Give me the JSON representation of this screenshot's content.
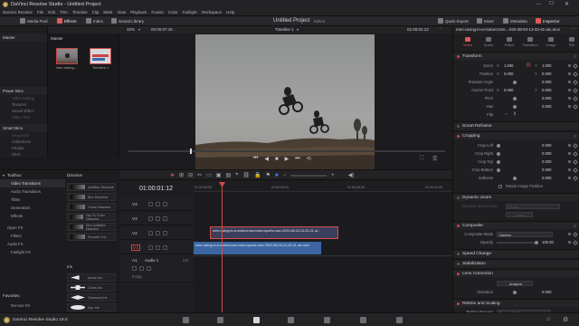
{
  "window": {
    "title": "DaVinci Resolve Studio - Untitled Project"
  },
  "menu": [
    "DaVinci Resolve",
    "File",
    "Edit",
    "Trim",
    "Timeline",
    "Clip",
    "Mark",
    "View",
    "Playback",
    "Fusion",
    "Color",
    "Fairlight",
    "Workspace",
    "Help"
  ],
  "project": {
    "name": "Untitled Project",
    "status": "Edited"
  },
  "toolbar": {
    "media_pool": "Media Pool",
    "effects": "Effects",
    "index": "Index",
    "sound_library": "Sound Library",
    "quick_export": "Quick Export",
    "mixer": "Mixer",
    "metadata": "Metadata",
    "inspector": "Inspector"
  },
  "left_panel": {
    "master": "Master",
    "power_bins": "Power Bins",
    "power_items": [
      "Video Editing",
      "Textures",
      "Sound Effect",
      "Video Tour"
    ],
    "smart_bins": "Smart Bins",
    "smart_items": [
      "Keywords",
      "Collections",
      "People",
      "Shot"
    ]
  },
  "media_pool": {
    "bin": "Master",
    "clips": [
      {
        "name": "men-racing-..."
      },
      {
        "name": "Timeline 1"
      }
    ]
  },
  "viewer": {
    "zoom": "32%",
    "source_timecode": "00:00:07:15",
    "timeline_name": "Timeline 1",
    "timecode": "01:00:01:12",
    "clip_file": "men-racing-in-a-motorcross-...022-08-04-13-23-41-utc.mov"
  },
  "effects_library": {
    "toolbox": "Toolbox",
    "items": [
      "Video Transitions",
      "Audio Transitions",
      "Titles",
      "Generators",
      "Effects",
      "Open FX",
      "Filters",
      "Audio FX",
      "Fairlight FX"
    ],
    "selected": "Video Transitions",
    "dissolve_header": "Dissolve",
    "dissolve_items": [
      "Additive Dissolve",
      "Blur Dissolve",
      "Cross Dissolve",
      "Dip To Color Dissolve",
      "Non-Additive Dissolve",
      "Smooth Cut"
    ],
    "iris_header": "Iris",
    "iris_items": [
      "Arrow Iris",
      "Cross Iris",
      "Diamond Iris",
      "Eye Iris"
    ],
    "favorites": "Favorites",
    "favorite_item": "Remote R3"
  },
  "timeline": {
    "timecode": "01:00:01:12",
    "ruler": [
      "01:00:00:00",
      "01:00:04:00",
      "01:00:08:00",
      "01:00:12:00"
    ],
    "tracks": [
      {
        "name": "V4",
        "type": "video"
      },
      {
        "name": "V3",
        "type": "video"
      },
      {
        "name": "V2",
        "type": "video"
      },
      {
        "name": "V1",
        "type": "video"
      },
      {
        "name": "A1",
        "type": "audio",
        "label": "Audio 1",
        "count": "2.0",
        "clips": "0 Clip"
      }
    ],
    "clips": [
      {
        "track": "V2",
        "name": "men-racing-in-a-motorcross-motor-sports-race-2022-08-04-13-23-41-ut..."
      },
      {
        "track": "V1",
        "name": "men-racing-in-a-motorcross-motor-sports-race-2022-08-04-13-23-41-utc.mov"
      }
    ]
  },
  "inspector": {
    "file": "men-racing-in-a-motorcross-...022-08-04-13-23-41-utc.mov",
    "tabs": [
      "Video",
      "Audio",
      "Effect",
      "Transition",
      "Image",
      "File"
    ],
    "active_tab": "Video",
    "transform": {
      "title": "Transform",
      "zoom_x": "1.000",
      "zoom_y": "1.000",
      "position_x": "0.000",
      "position_y": "0.000",
      "rotation": "0.000",
      "anchor_x": "0.000",
      "anchor_y": "0.000",
      "pitch": "0.000",
      "yaw": "0.000",
      "labels": [
        "Zoom",
        "Position",
        "Rotation Angle",
        "Anchor Point",
        "Pitch",
        "Yaw",
        "Flip"
      ]
    },
    "smart_reframe": "Smart Reframe",
    "cropping": {
      "title": "Cropping",
      "labels": [
        "Crop Left",
        "Crop Right",
        "Crop Top",
        "Crop Bottom",
        "Softness"
      ],
      "values": [
        "0.000",
        "0.000",
        "0.000",
        "0.000",
        "0.000"
      ],
      "retain": "Retain Image Position"
    },
    "dynamic_zoom": {
      "title": "Dynamic Zoom",
      "ease": "Dynamic Zoom Ease",
      "ease_value": "Linear",
      "swap": "Swap"
    },
    "composite": {
      "title": "Composite",
      "mode_label": "Composite Mode",
      "mode_value": "Darken",
      "opacity_label": "Opacity",
      "opacity_value": "100.00"
    },
    "speed_change": "Speed Change",
    "stabilization": "Stabilization",
    "lens_correction": {
      "title": "Lens Correction",
      "analyze": "Analyze",
      "distortion_label": "Distortion",
      "distortion_value": "0.000"
    },
    "retime": {
      "title": "Retime and Scaling",
      "process_label": "Retime Process",
      "process_value": "Project Settings"
    }
  },
  "bottom": {
    "app": "DaVinci Resolve Studio 18.5"
  }
}
